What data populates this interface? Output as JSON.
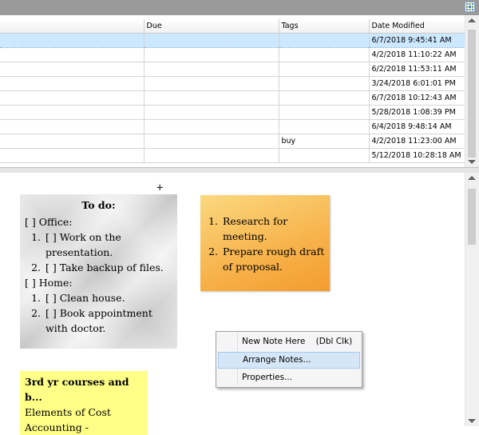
{
  "table": {
    "columns": [
      "",
      "Due",
      "Tags",
      "Date Modified"
    ],
    "rows": [
      {
        "title": "",
        "due": "",
        "tags": "",
        "modified": "6/7/2018 9:45:41 AM",
        "selected": true
      },
      {
        "title": "",
        "due": "",
        "tags": "",
        "modified": "4/2/2018 11:10:22 AM"
      },
      {
        "title": "",
        "due": "",
        "tags": "",
        "modified": "6/2/2018 11:53:11 AM"
      },
      {
        "title": "",
        "due": "",
        "tags": "",
        "modified": "3/24/2018 6:01:01 PM"
      },
      {
        "title": "",
        "due": "",
        "tags": "",
        "modified": "6/7/2018 10:12:43 AM"
      },
      {
        "title": "",
        "due": "",
        "tags": "",
        "modified": "5/28/2018 1:08:39 PM"
      },
      {
        "title": "",
        "due": "",
        "tags": "",
        "modified": "6/4/2018 9:48:14 AM"
      },
      {
        "title": "",
        "due": "",
        "tags": "buy",
        "modified": "4/2/2018 11:23:00 AM"
      },
      {
        "title": "",
        "due": "",
        "tags": "",
        "modified": "5/12/2018 10:28:18 AM"
      }
    ]
  },
  "notes": {
    "todo": {
      "title": "To do:",
      "office_header": "[ ] Office:",
      "office_items": [
        "[ ] Work on the presentation.",
        "[ ] Take backup of files."
      ],
      "home_header": "[ ] Home:",
      "home_items": [
        "[ ] Clean house.",
        "[ ] Book appointment with doctor."
      ]
    },
    "research": {
      "items": [
        "Research for meeting.",
        "Prepare rough draft of proposal."
      ]
    },
    "courses": {
      "title": "3rd yr courses and b...",
      "line1": "Elements of Cost",
      "line2": "Accounting -"
    }
  },
  "context_menu": {
    "items": [
      {
        "label": "New Note Here    (Dbl Clk)"
      },
      {
        "label": "Arrange Notes...",
        "highlighted": true
      },
      {
        "label": "Properties..."
      }
    ]
  },
  "crosshair": "+"
}
